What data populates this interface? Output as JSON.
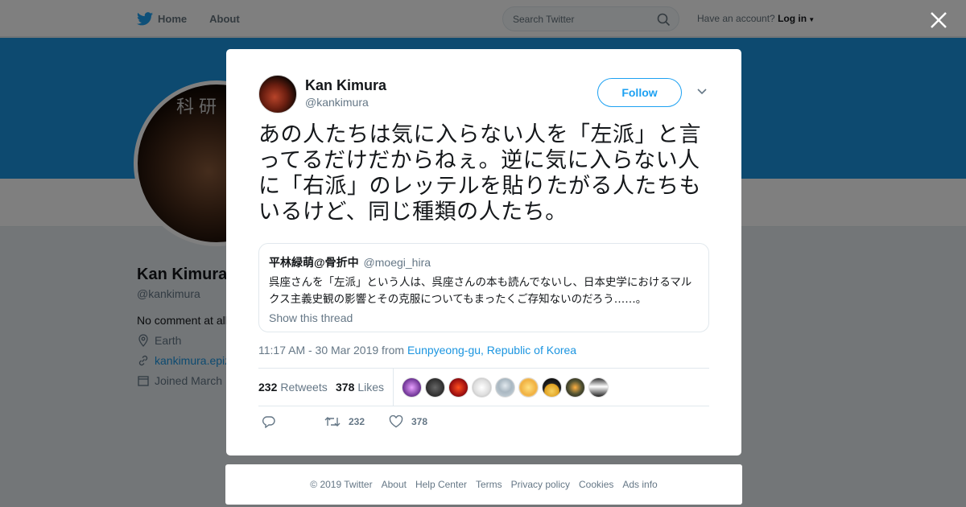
{
  "nav": {
    "home": "Home",
    "about": "About",
    "search_placeholder": "Search Twitter",
    "have_account": "Have an account?",
    "login": "Log in"
  },
  "profile": {
    "name": "Kan Kimura",
    "handle": "@kankimura",
    "bio": "No comment at all",
    "location": "Earth",
    "website": "kankimura.epiz",
    "joined": "Joined March",
    "avatar_text": "科研"
  },
  "tweet": {
    "author_name": "Kan Kimura",
    "author_handle": "@kankimura",
    "follow_label": "Follow",
    "text": "あの人たちは気に入らない人を「左派」と言ってるだけだからねぇ。逆に気に入らない人に「右派」のレッテルを貼りたがる人たちもいるけど、同じ種類の人たち。",
    "quote": {
      "name": "平林緑萌@骨折中",
      "handle": "@moegi_hira",
      "text": "呉座さんを「左派」という人は、呉座さんの本も読んでないし、日本史学におけるマルクス主義史観の影響とその克服についてもまったくご存知ないのだろう……。",
      "show_thread": "Show this thread"
    },
    "time": "11:17 AM - 30 Mar 2019 from",
    "location": "Eunpyeong-gu, Republic of Korea",
    "retweets_count": "232",
    "retweets_label": "Retweets",
    "likes_count": "378",
    "likes_label": "Likes",
    "action_retweets": "232",
    "action_likes": "378"
  },
  "footer": {
    "copyright": "© 2019 Twitter",
    "about": "About",
    "help": "Help Center",
    "terms": "Terms",
    "privacy": "Privacy policy",
    "cookies": "Cookies",
    "ads": "Ads info"
  },
  "colors": {
    "twitter_blue": "#1da1f2",
    "banner": "#1b95e0",
    "link": "#1b95e0"
  }
}
